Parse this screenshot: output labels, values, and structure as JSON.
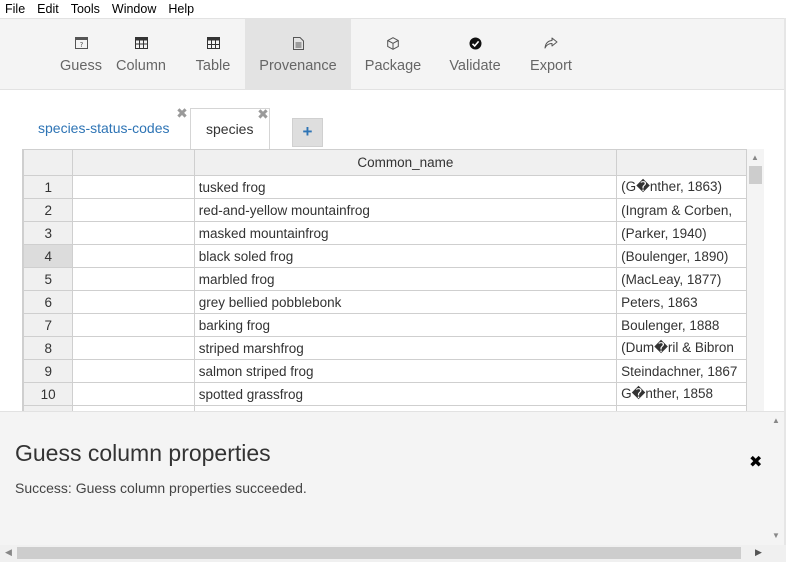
{
  "menu": [
    "File",
    "Edit",
    "Tools",
    "Window",
    "Help"
  ],
  "toolbar": [
    {
      "label": "Guess",
      "icon": "guess-icon"
    },
    {
      "label": "Column",
      "icon": "column-icon"
    },
    {
      "label": "Table",
      "icon": "table-icon"
    },
    {
      "label": "Provenance",
      "icon": "provenance-icon",
      "active": true
    },
    {
      "label": "Package",
      "icon": "package-icon"
    },
    {
      "label": "Validate",
      "icon": "validate-icon"
    },
    {
      "label": "Export",
      "icon": "export-icon"
    }
  ],
  "tabs": [
    {
      "label": "species-status-codes",
      "active": false
    },
    {
      "label": "species",
      "active": true
    }
  ],
  "add_tab_label": "+",
  "grid": {
    "header": [
      "",
      "",
      "Common_name",
      ""
    ],
    "selected_row": 4,
    "rows": [
      {
        "n": "1",
        "name": "tusked frog",
        "author": "(G�nther, 1863)"
      },
      {
        "n": "2",
        "name": "red-and-yellow mountainfrog",
        "author": "(Ingram & Corben,"
      },
      {
        "n": "3",
        "name": "masked mountainfrog",
        "author": "(Parker, 1940)"
      },
      {
        "n": "4",
        "name": "black soled frog",
        "author": "(Boulenger, 1890)"
      },
      {
        "n": "5",
        "name": "marbled frog",
        "author": "(MacLeay, 1877)"
      },
      {
        "n": "6",
        "name": "grey bellied pobblebonk",
        "author": "Peters, 1863"
      },
      {
        "n": "7",
        "name": "barking frog",
        "author": "Boulenger, 1888"
      },
      {
        "n": "8",
        "name": "striped marshfrog",
        "author": "(Dum�ril & Bibron"
      },
      {
        "n": "9",
        "name": "salmon striped frog",
        "author": "Steindachner, 1867"
      },
      {
        "n": "10",
        "name": "spotted grassfrog",
        "author": "G�nther, 1858"
      }
    ]
  },
  "panel": {
    "title": "Guess column properties",
    "message": "Success: Guess column properties succeeded.",
    "close": "✖"
  }
}
